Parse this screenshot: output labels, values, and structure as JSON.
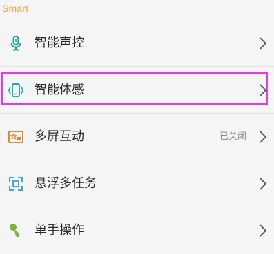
{
  "section": {
    "title": "Smart"
  },
  "rows": [
    {
      "label": "智能声控",
      "icon": "microphone-icon",
      "status": ""
    },
    {
      "label": "智能体感",
      "icon": "phone-gesture-icon",
      "status": ""
    },
    {
      "label": "多屏互动",
      "icon": "multiscreen-icon",
      "status": "已关闭"
    },
    {
      "label": "悬浮多任务",
      "icon": "floating-tasks-icon",
      "status": ""
    },
    {
      "label": "单手操作",
      "icon": "one-hand-icon",
      "status": ""
    }
  ],
  "colors": {
    "section_title": "#f0a548",
    "mic_icon": "#1aa39a",
    "gesture_icon": "#1aa9c7",
    "multiscreen_icon": "#e08a2a",
    "floating_icon": "#3aa7d8",
    "one_hand_icon": "#7bb23a",
    "highlight": "#e040d8"
  }
}
